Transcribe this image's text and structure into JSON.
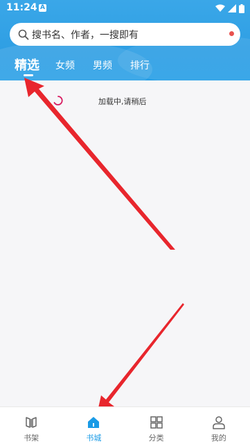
{
  "status_bar": {
    "time": "11:24",
    "notification_icon": "A",
    "icons": [
      "wifi-icon",
      "signal-icon",
      "battery-icon"
    ]
  },
  "search": {
    "placeholder": "搜书名、作者，一搜即有",
    "has_notification_dot": true
  },
  "tabs": [
    {
      "label": "精选",
      "active": true
    },
    {
      "label": "女频",
      "active": false
    },
    {
      "label": "男频",
      "active": false
    },
    {
      "label": "排行",
      "active": false
    }
  ],
  "loading": {
    "text": "加载中,请稍后"
  },
  "bottom_nav": [
    {
      "label": "书架",
      "icon": "bookshelf-icon",
      "active": false
    },
    {
      "label": "书城",
      "icon": "home-icon",
      "active": true
    },
    {
      "label": "分类",
      "icon": "grid-icon",
      "active": false
    },
    {
      "label": "我的",
      "icon": "person-icon",
      "active": false
    }
  ],
  "colors": {
    "header": "#2f9fe4",
    "accent": "#1a9be6",
    "annotation_arrow": "#e8262d"
  }
}
